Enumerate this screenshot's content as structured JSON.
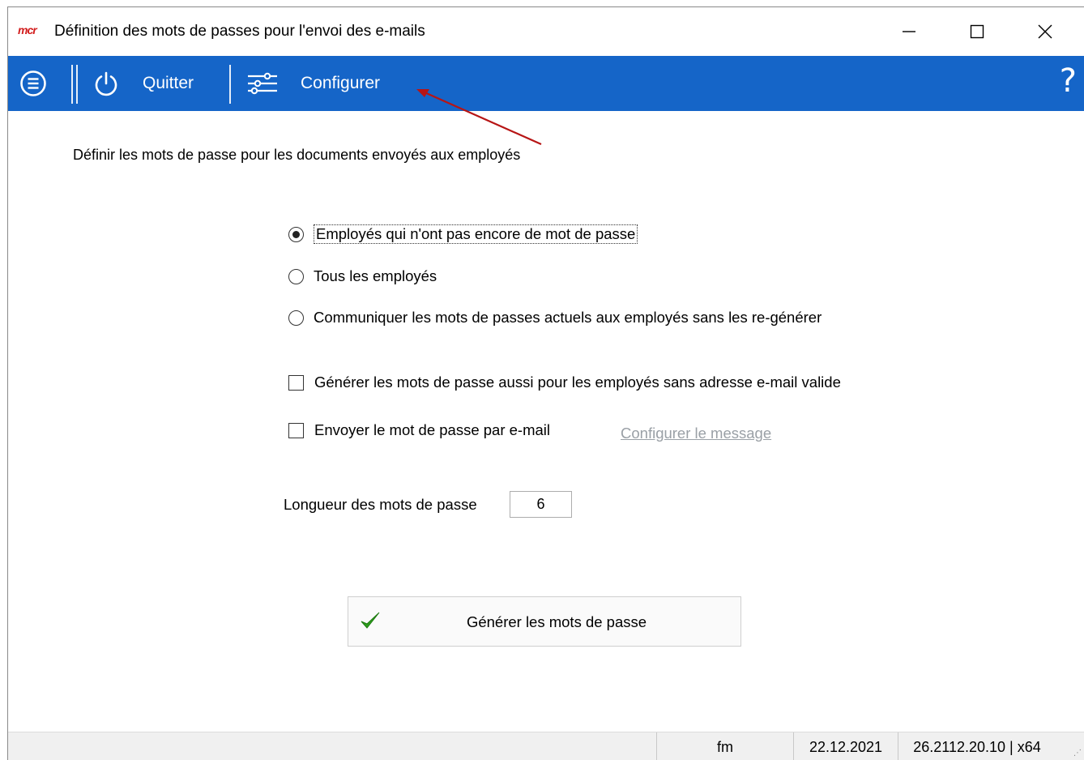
{
  "window": {
    "logo": "mcr",
    "title": "Définition des mots de passes pour l'envoi des e-mails"
  },
  "toolbar": {
    "quit_label": "Quitter",
    "configure_label": "Configurer",
    "help_label": "?",
    "color": "#1565c8"
  },
  "main": {
    "heading": "Définir les mots de passe pour les documents envoyés aux employés",
    "radios": [
      {
        "label": "Employés qui n'ont pas encore de mot de passe",
        "selected": true
      },
      {
        "label": "Tous les employés",
        "selected": false
      },
      {
        "label": "Communiquer les mots de passes actuels aux employés sans les re-générer",
        "selected": false
      }
    ],
    "checkboxes": [
      {
        "label": "Générer les mots de passe aussi pour les employés sans adresse e-mail valide",
        "checked": false
      },
      {
        "label": "Envoyer le mot de passe par e-mail",
        "checked": false
      }
    ],
    "configure_message_link": "Configurer le message",
    "length_label": "Longueur des mots de passe",
    "length_value": "6",
    "generate_button": "Générer les mots de passe"
  },
  "statusbar": {
    "user": "fm",
    "date": "22.12.2021",
    "version": "26.2112.20.10 | x64"
  }
}
